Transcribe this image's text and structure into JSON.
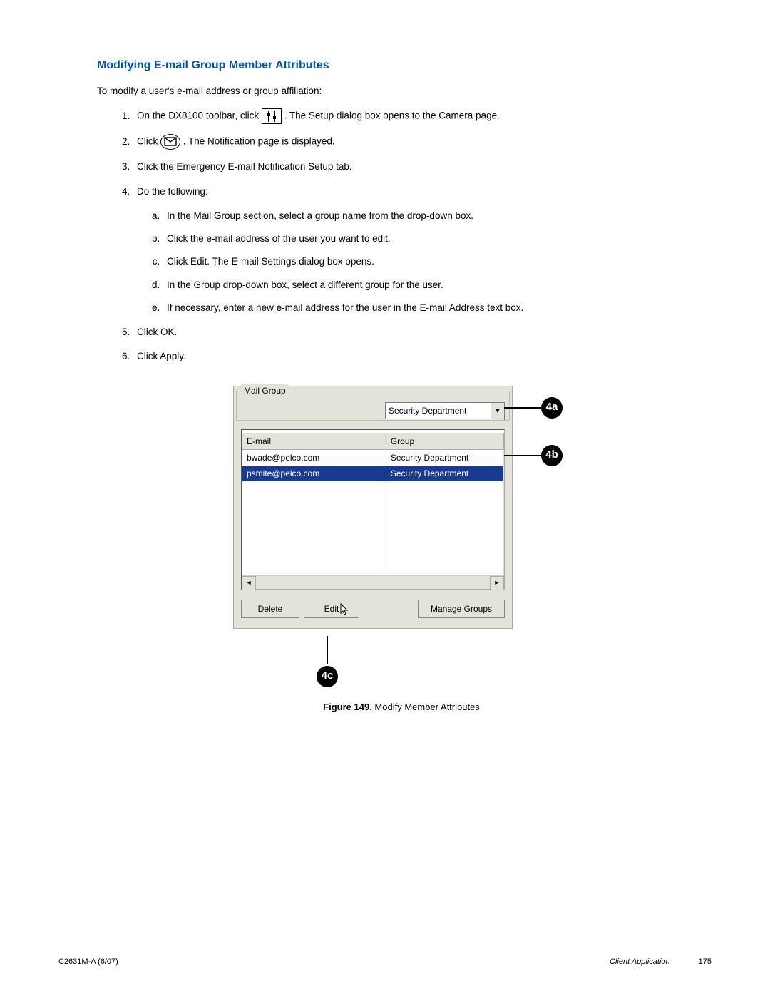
{
  "heading": "Modifying E-mail Group Member Attributes",
  "intro": "To modify a user's e-mail address or group affiliation:",
  "steps": {
    "s1a": "On the DX8100 toolbar, click ",
    "s1b": ". The Setup dialog box opens to the Camera page.",
    "s2a": "Click ",
    "s2b": ". The Notification page is displayed.",
    "s3": "Click the Emergency E-mail Notification Setup tab.",
    "s4": "Do the following:",
    "s4a": "In the Mail Group section, select a group name from the drop-down box.",
    "s4b": "Click the e-mail address of the user you want to edit.",
    "s4c": "Click Edit. The E-mail Settings dialog box opens.",
    "s4d": "In the Group drop-down box, select a different group for the user.",
    "s4e": "If necessary, enter a new e-mail address for the user in the E-mail Address text box.",
    "s5": "Click OK.",
    "s6": "Click Apply."
  },
  "panel": {
    "legend": "Mail Group",
    "dropdown_value": "Security Department",
    "col_email": "E-mail",
    "col_group": "Group",
    "rows": [
      {
        "email": "bwade@pelco.com",
        "group": "Security Department",
        "selected": false
      },
      {
        "email": "psmite@pelco.com",
        "group": "Security Department",
        "selected": true
      }
    ],
    "btn_delete": "Delete",
    "btn_edit": "Edit",
    "btn_manage": "Manage Groups"
  },
  "callouts": {
    "a": "4a",
    "b": "4b",
    "c": "4c"
  },
  "caption_label": "Figure 149.",
  "caption_text": "  Modify Member Attributes",
  "footer": {
    "left": "C2631M-A (6/07)",
    "app": "Client Application",
    "page": "175"
  }
}
